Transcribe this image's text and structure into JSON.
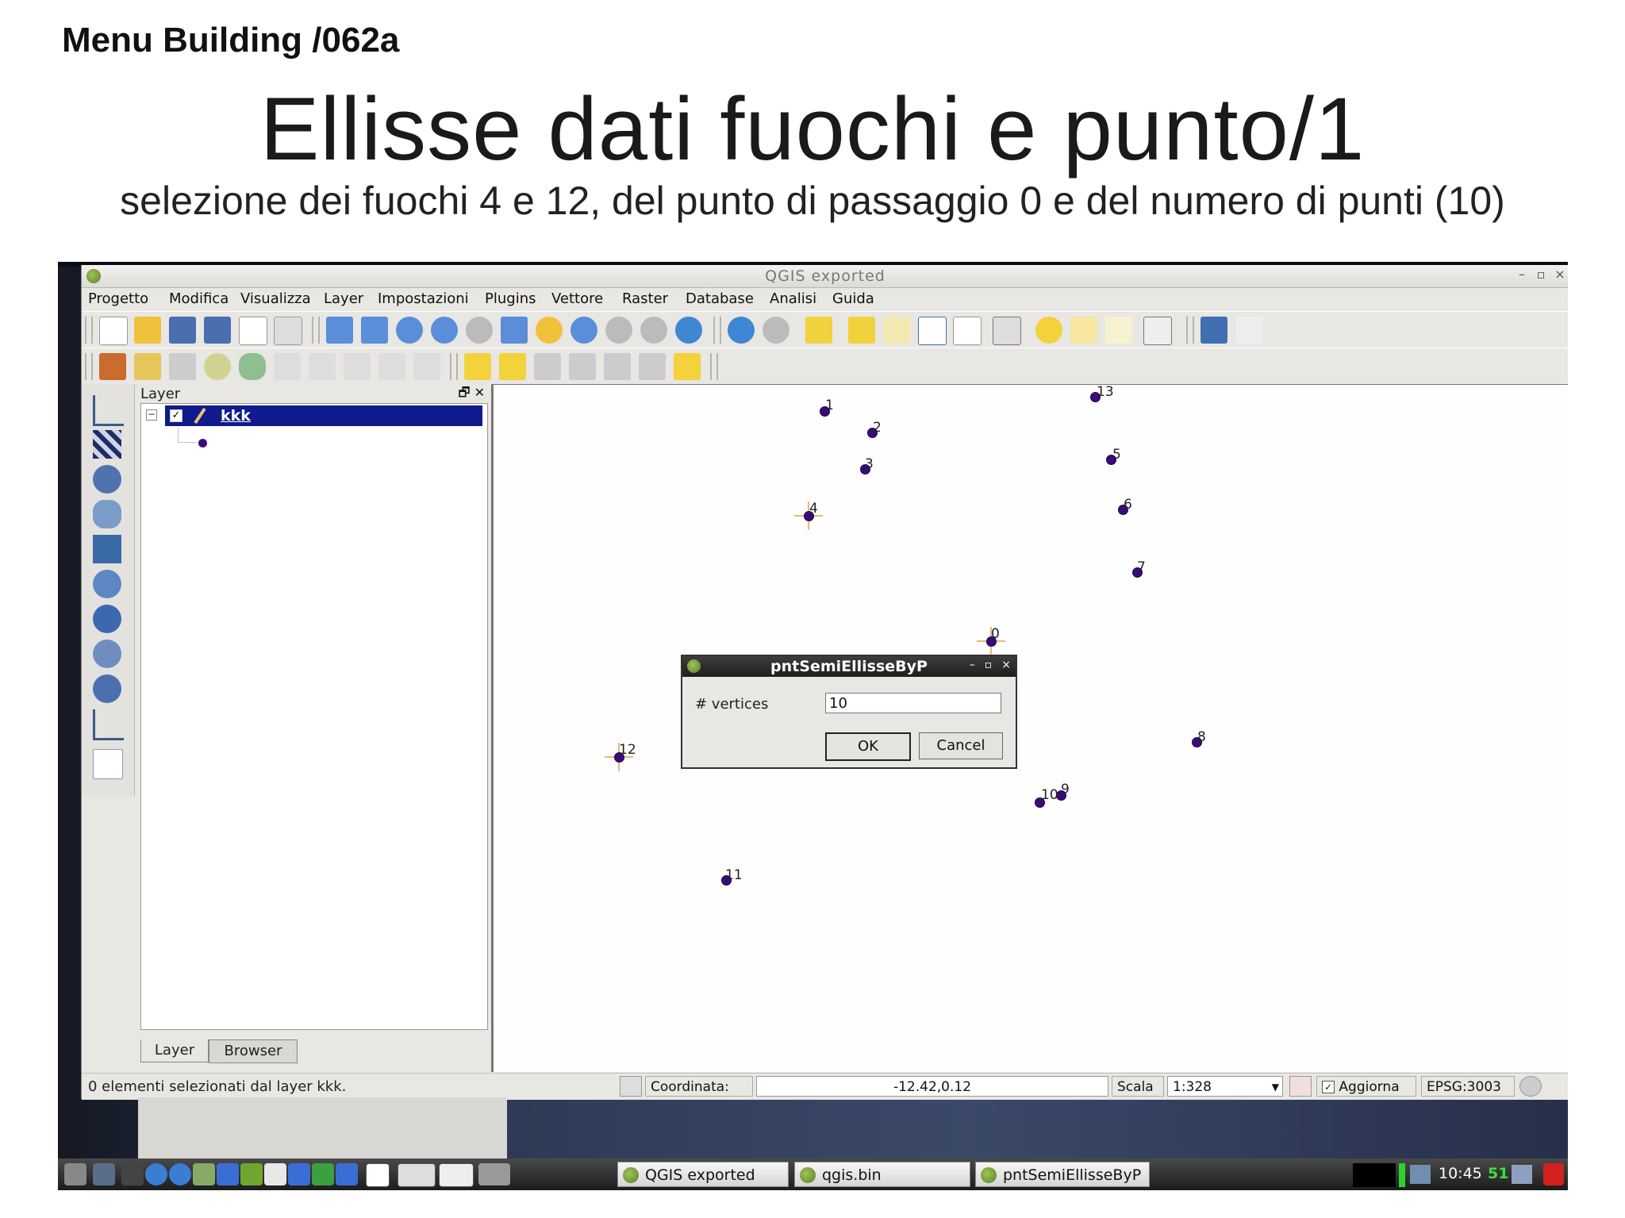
{
  "slide": {
    "header": "Menu Building /062a",
    "title": "Ellisse dati fuochi e  punto/1",
    "subtitle": "selezione dei fuochi 4 e 12, del punto di passaggio 0 e del numero di punti (10)"
  },
  "window": {
    "title": "QGIS exported",
    "controls": [
      "–",
      "▫",
      "×"
    ]
  },
  "menu": [
    "Progetto",
    "Modifica",
    "Visualizza",
    "Layer",
    "Impostazioni",
    "Plugins",
    "Vettore",
    "Raster",
    "Database",
    "Analisi",
    "Guida"
  ],
  "layer_panel": {
    "title": "Layer",
    "controls": "🗗 ✕",
    "layer_name": "kkk",
    "tabs": [
      "Layer",
      "Browser"
    ]
  },
  "map": {
    "points": [
      {
        "label": "1"
      },
      {
        "label": "2"
      },
      {
        "label": "3"
      },
      {
        "label": "4"
      },
      {
        "label": "5"
      },
      {
        "label": "6"
      },
      {
        "label": "7"
      },
      {
        "label": "8"
      },
      {
        "label": "9"
      },
      {
        "label": "10"
      },
      {
        "label": "11"
      },
      {
        "label": "12"
      },
      {
        "label": "13"
      },
      {
        "label": "0"
      }
    ]
  },
  "dialog": {
    "title": "pntSemiEllisseByP",
    "field_label": "# vertices",
    "field_value": "10",
    "ok": "OK",
    "cancel": "Cancel"
  },
  "statusbar": {
    "message": "0 elementi selezionati dal layer kkk.",
    "coord_label": "Coordinata:",
    "coord_value": "-12.42,0.12",
    "scale_label": "Scala",
    "scale_value": "1:328",
    "render_label": "Aggiorna",
    "crs": "EPSG:3003"
  },
  "taskbar": {
    "tasks": [
      "QGIS exported",
      "qgis.bin",
      "pntSemiEllisseByP"
    ],
    "clock": "10:45",
    "workspace": "51"
  }
}
